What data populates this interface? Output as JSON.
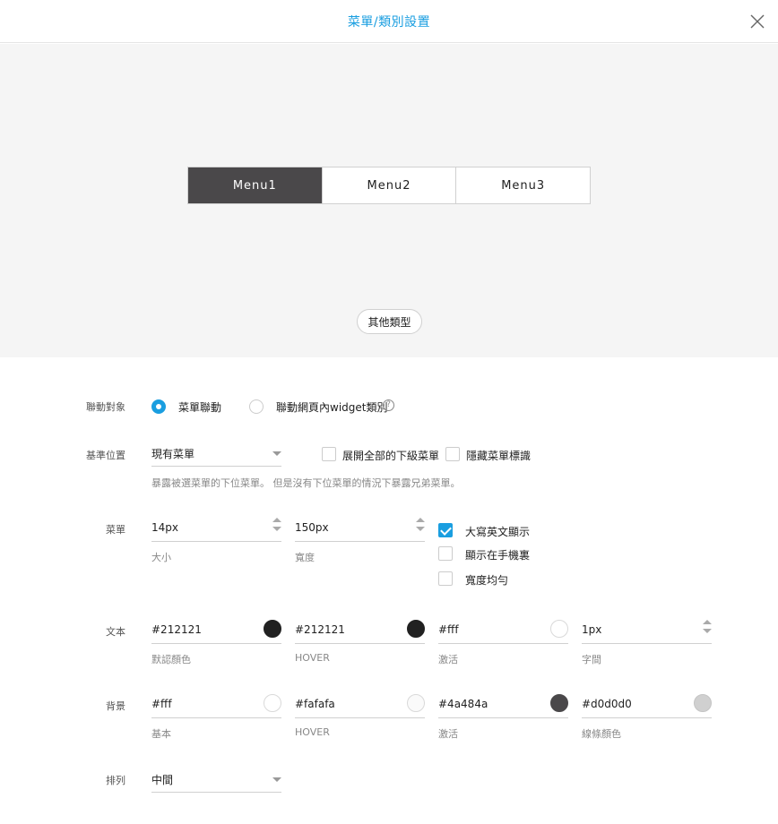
{
  "header": {
    "title": "菜單/類別設置"
  },
  "preview": {
    "menu_items": [
      "Menu1",
      "Menu2",
      "Menu3"
    ],
    "other_button": "其他類型"
  },
  "link": {
    "label": "聯動對象",
    "option1": "菜單聯動",
    "option2": "聯動網頁內widget類別"
  },
  "position": {
    "label": "基準位置",
    "select_value": "現有菜單",
    "expand_all": "展開全部的下級菜單",
    "hide_mark": "隱藏菜單標識",
    "note": "暴露被選菜單的下位菜單。 但是沒有下位菜單的情況下暴露兄弟菜單。"
  },
  "menu": {
    "label": "菜單",
    "size_value": "14px",
    "size_caption": "大小",
    "width_value": "150px",
    "width_caption": "寬度",
    "uppercase": "大寫英文顯示",
    "show_mobile": "顯示在手機裏",
    "equal_width": "寬度均勻"
  },
  "text": {
    "label": "文本",
    "default_color": "#212121",
    "default_caption": "默認顏色",
    "hover_color": "#212121",
    "hover_caption": "HOVER",
    "active_color": "#fff",
    "active_caption": "激活",
    "spacing_value": "1px",
    "spacing_caption": "字間"
  },
  "background": {
    "label": "背景",
    "base_color": "#fff",
    "base_caption": "基本",
    "hover_color": "#fafafa",
    "hover_caption": "HOVER",
    "active_color": "#4a484a",
    "active_caption": "激活",
    "line_color": "#d0d0d0",
    "line_caption": "線條顏色"
  },
  "arrange": {
    "label": "排列",
    "select_value": "中間"
  },
  "colors": {
    "accent": "#1a9ee0",
    "menu_active_bg": "#4a484a",
    "swatch_text_default": "#212121",
    "swatch_text_hover": "#212121",
    "swatch_text_active": "#ffffff",
    "swatch_bg_base": "#ffffff",
    "swatch_bg_hover": "#fafafa",
    "swatch_bg_active": "#4a484a",
    "swatch_bg_line": "#d0d0d0"
  },
  "icons": {
    "close": "close-icon",
    "help": "help-icon",
    "dropdown": "chevron-down-icon",
    "spinner": "stepper-icon"
  }
}
